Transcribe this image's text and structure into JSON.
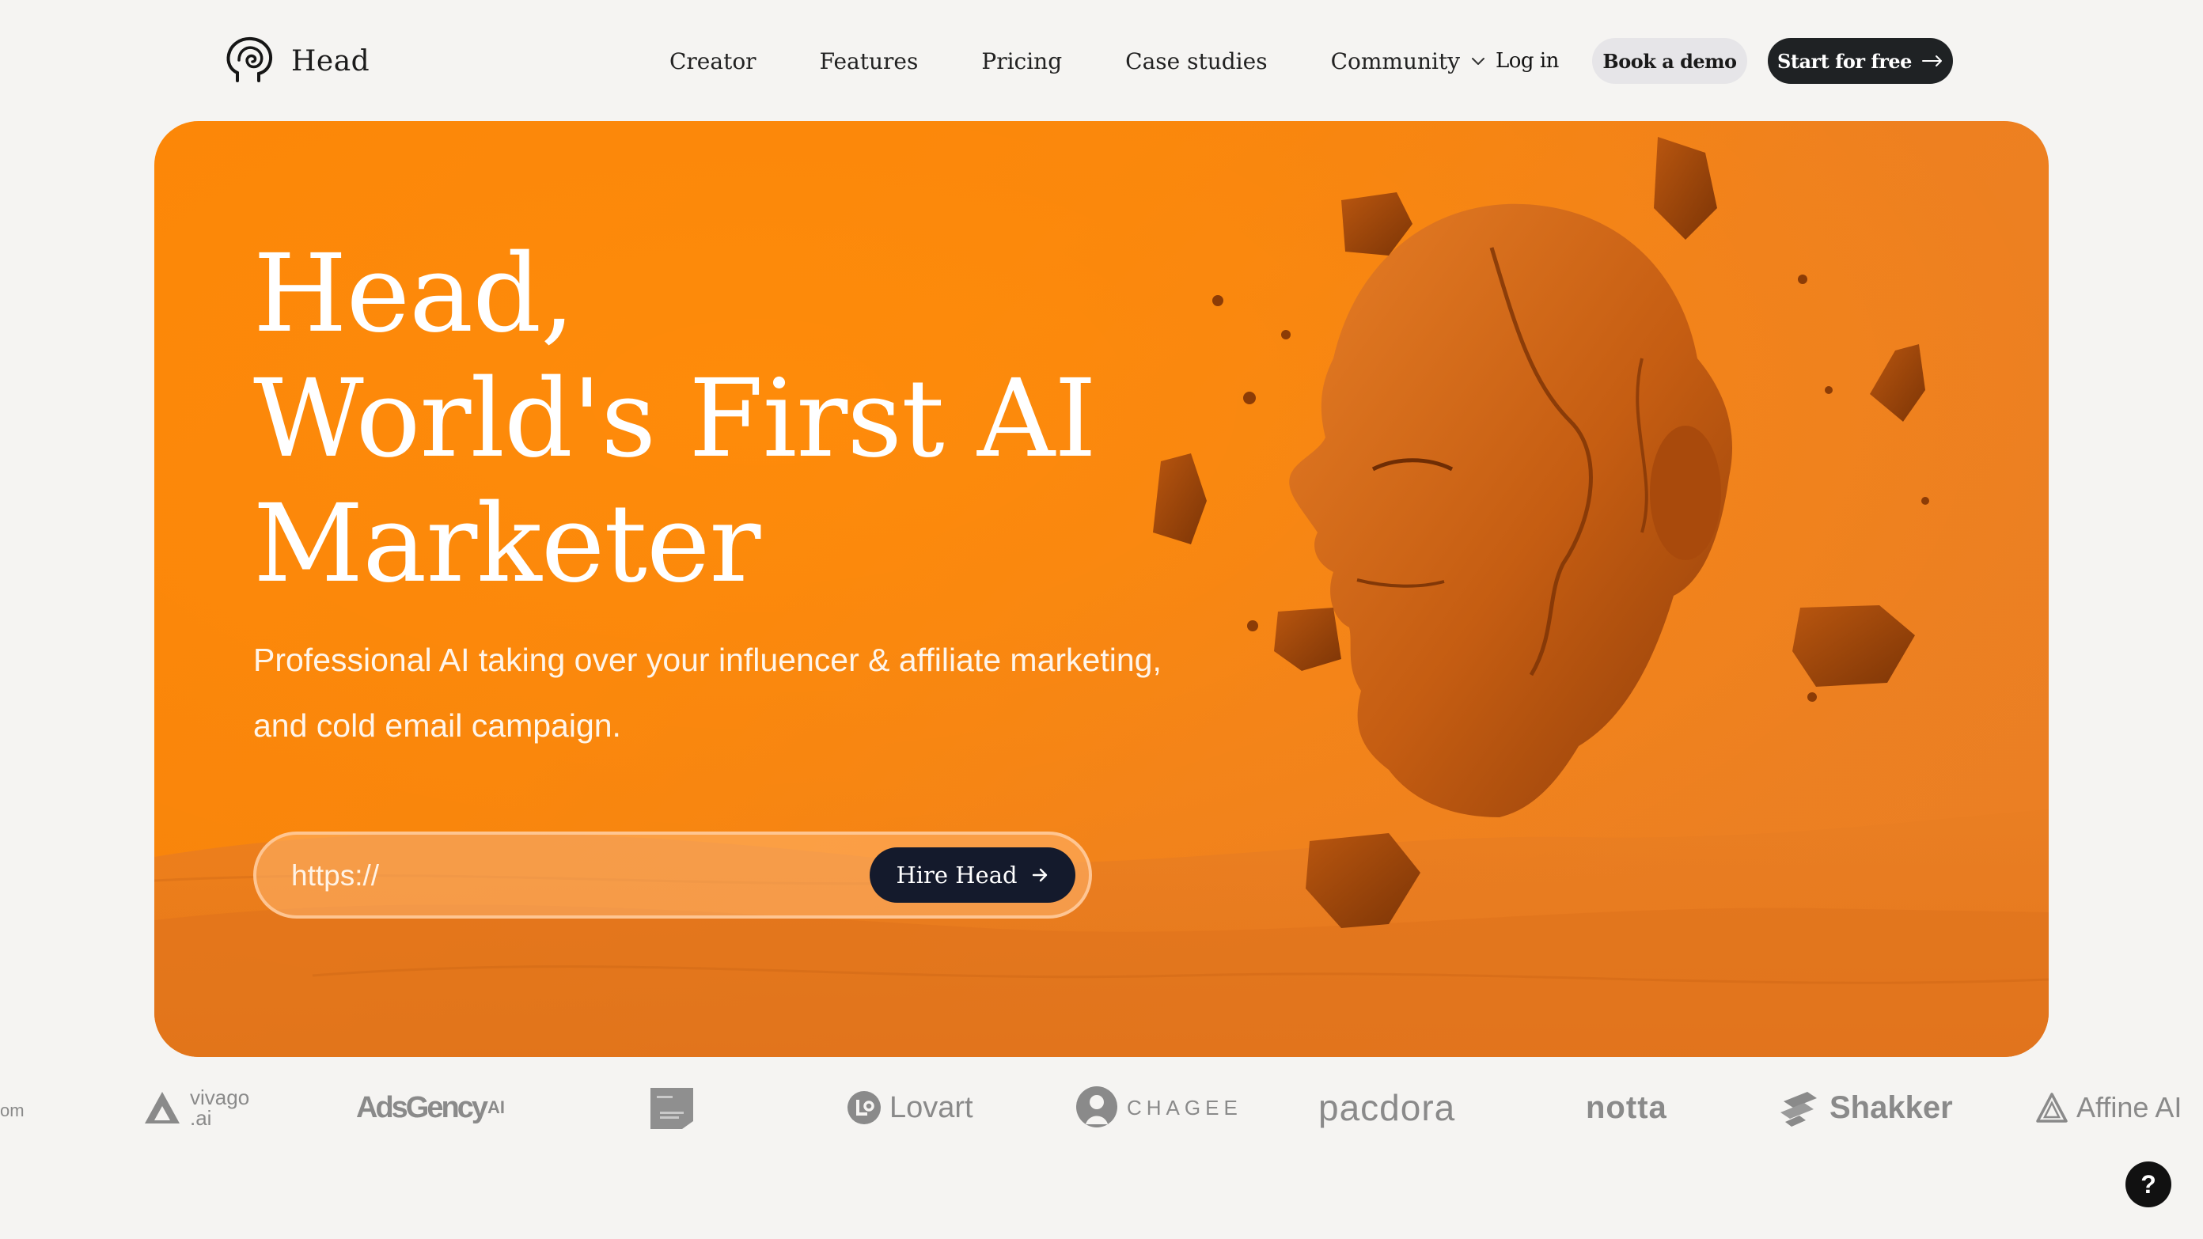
{
  "brand": {
    "name": "Head",
    "logo_icon": "head-outline-icon"
  },
  "nav": {
    "items": [
      {
        "label": "Creator"
      },
      {
        "label": "Features"
      },
      {
        "label": "Pricing"
      },
      {
        "label": "Case studies"
      },
      {
        "label": "Community",
        "icon": "chevron-down-icon"
      }
    ],
    "login_label": "Log in",
    "demo_label": "Book a demo",
    "start_label": "Start for free",
    "start_icon": "arrow-right-icon"
  },
  "hero": {
    "title_lines": [
      "Head,",
      "World's First AI",
      "Marketer"
    ],
    "subtitle": "Professional AI taking over your influencer & affiliate marketing, and cold email campaign.",
    "url_placeholder": "https://",
    "cta_label": "Hire Head",
    "cta_icon": "arrow-right-icon",
    "background_color": "#f7840d",
    "image": "sculpted-head-in-desert-illustration"
  },
  "logos": {
    "partial_left": "om",
    "items": [
      {
        "name": "vivago .ai",
        "line1": "vivago",
        "line2": ".ai",
        "icon": "vivago-triangle-icon"
      },
      {
        "name": "AdsGency AI",
        "text": "AdsGency",
        "suffix": "AI"
      },
      {
        "name": "AWS qualified software badge",
        "icon": "aws-badge-icon"
      },
      {
        "name": "Lovart",
        "text": "Lovart",
        "icon": "lovart-circle-icon"
      },
      {
        "name": "CHAGEE",
        "text": "CHAGEE",
        "icon": "chagee-emblem-icon"
      },
      {
        "name": "pacdora",
        "text": "pacdora"
      },
      {
        "name": "notta",
        "text": "notta"
      },
      {
        "name": "Shakker",
        "text": "Shakker",
        "icon": "shakker-icon"
      },
      {
        "name": "Affine AI",
        "text": "Affine AI",
        "icon": "affine-triangle-icon"
      }
    ]
  },
  "help": {
    "label": "?"
  },
  "colors": {
    "accent": "#f7840d",
    "dark": "#1f2224",
    "cta_dark": "#141a2c",
    "page_bg": "#f5f4f2"
  }
}
